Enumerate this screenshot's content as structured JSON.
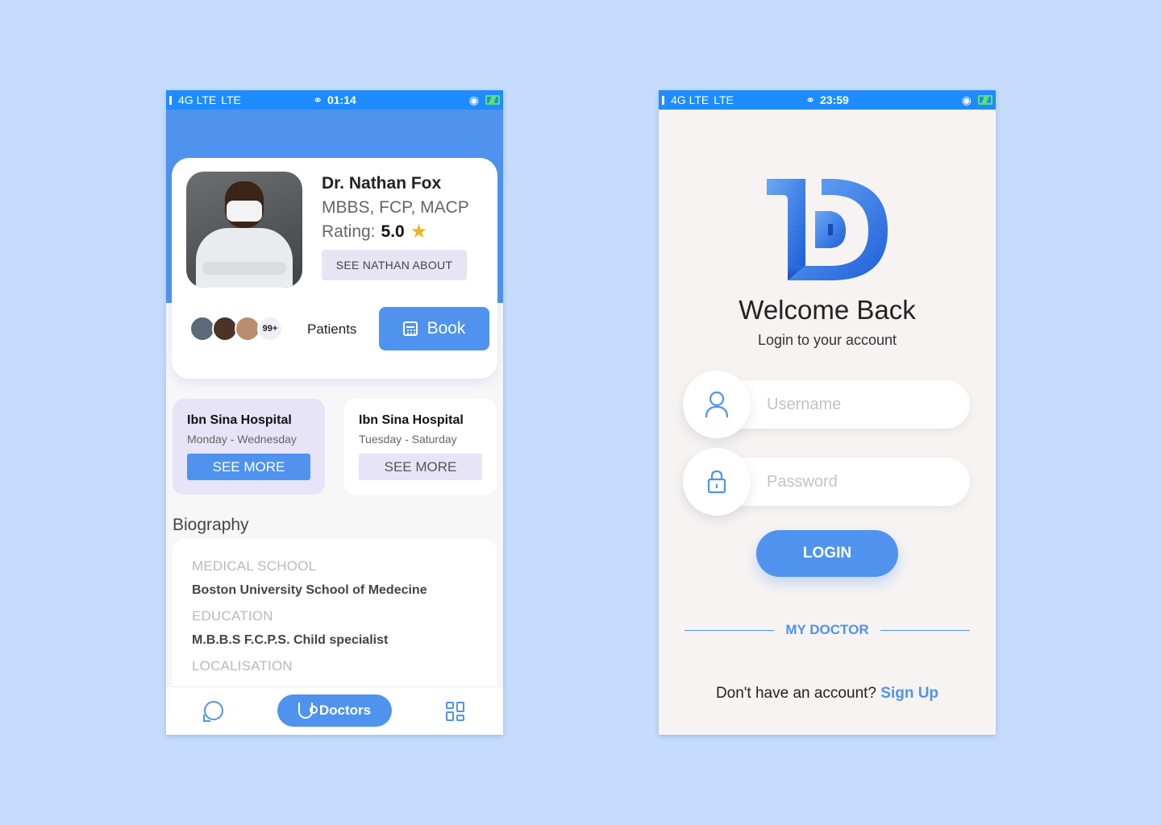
{
  "left_phone": {
    "status": {
      "network": "4G LTE",
      "network2": "LTE",
      "time": "01:14"
    },
    "doctor": {
      "name": "Dr. Nathan Fox",
      "credentials": "MBBS, FCP, MACP",
      "rating_label": "Rating:",
      "rating_value": "5.0",
      "see_about_label": "SEE NATHAN ABOUT"
    },
    "patients": {
      "count_badge": "99+",
      "label": "Patients"
    },
    "book_label": "Book",
    "hospitals": [
      {
        "name": "Ibn Sina Hospital",
        "days": "Monday - Wednesday",
        "button": "SEE MORE"
      },
      {
        "name": "Ibn Sina Hospital",
        "days": "Tuesday - Saturday",
        "button": "SEE MORE"
      }
    ],
    "biography": {
      "title": "Biography",
      "sections": [
        {
          "label": "MEDICAL SCHOOL",
          "value": "Boston University School of Medecine"
        },
        {
          "label": "EDUCATION",
          "value": "M.B.B.S F.C.P.S. Child specialist"
        },
        {
          "label": "LOCALISATION",
          "value": ""
        }
      ]
    },
    "nav": {
      "doctors_label": "Doctors"
    }
  },
  "right_phone": {
    "status": {
      "network": "4G LTE",
      "network2": "LTE",
      "time": "23:59"
    },
    "welcome": "Welcome Back",
    "subtitle": "Login to your account",
    "username_placeholder": "Username",
    "password_placeholder": "Password",
    "login_label": "LOGIN",
    "brand": "MY DOCTOR",
    "signup_prompt": "Don't have an account?",
    "signup_link": "Sign Up"
  },
  "colors": {
    "accent": "#4f93ee",
    "status_bar": "#1e8cff",
    "background": "#c5dcfc"
  }
}
